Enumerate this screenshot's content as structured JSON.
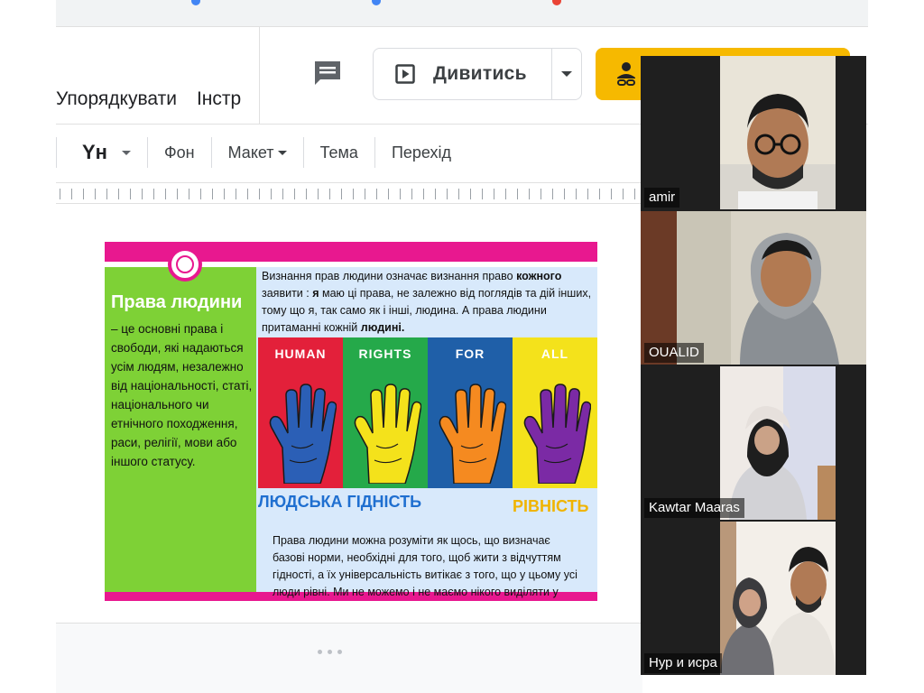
{
  "menu": {
    "arrange": "Упорядкувати",
    "tools_partial": "Інстр"
  },
  "present": {
    "label": "Дивитись"
  },
  "toolbar": {
    "font": "Yн",
    "background": "Фон",
    "layout": "Макет",
    "theme": "Тема",
    "transition": "Перехід"
  },
  "slide": {
    "left_title": "Права людини",
    "left_body": "– це основні права і свободи, які надаються усім людям, незалежно від національності, статі, національного чи етнічного походження, раси, релігії, мови або іншого статусу.",
    "top_text": {
      "p1": "Визнання прав людини означає визнання право ",
      "b1": "кожного",
      "p2": " заявити : ",
      "b2": "я",
      "p3": " маю ці права, не залежно від поглядів та дій інших, тому що я, так само як і інші, людина. А права людини притаманні кожній ",
      "b3": "людині."
    },
    "posters": [
      {
        "word": "HUMAN",
        "bg": "#e3203a",
        "hand": "#2b5fb6"
      },
      {
        "word": "RIGHTS",
        "bg": "#25a94a",
        "hand": "#f4e21b"
      },
      {
        "word": "FOR",
        "bg": "#1f5fa8",
        "hand": "#f58a20"
      },
      {
        "word": "ALL",
        "bg": "#f4e21b",
        "hand": "#7b2aa5"
      }
    ],
    "caption_dignity": "ЛЮДСЬКА ГІДНІСТЬ",
    "caption_equality": "РІВНІСТЬ",
    "bottom_text": "Права людини можна розуміти як щось, що визначає базові норми, необхідні для того, щоб жити з відчуттям гідності, а їх універсальність витікає з того, що у цьому усі люди рівні. Ми не можемо і не маємо нікого виділяти у"
  },
  "participants": [
    {
      "name": "amir"
    },
    {
      "name": "OUALID"
    },
    {
      "name": "Kawtar Maaras"
    },
    {
      "name": "Нур и исра"
    }
  ],
  "colors": {
    "accent_yellow": "#f6b900",
    "slide_pink": "#e8188f",
    "slide_green": "#7ed136",
    "slide_blue": "#d8e9fb",
    "active_speaker": "#8bc34a"
  }
}
